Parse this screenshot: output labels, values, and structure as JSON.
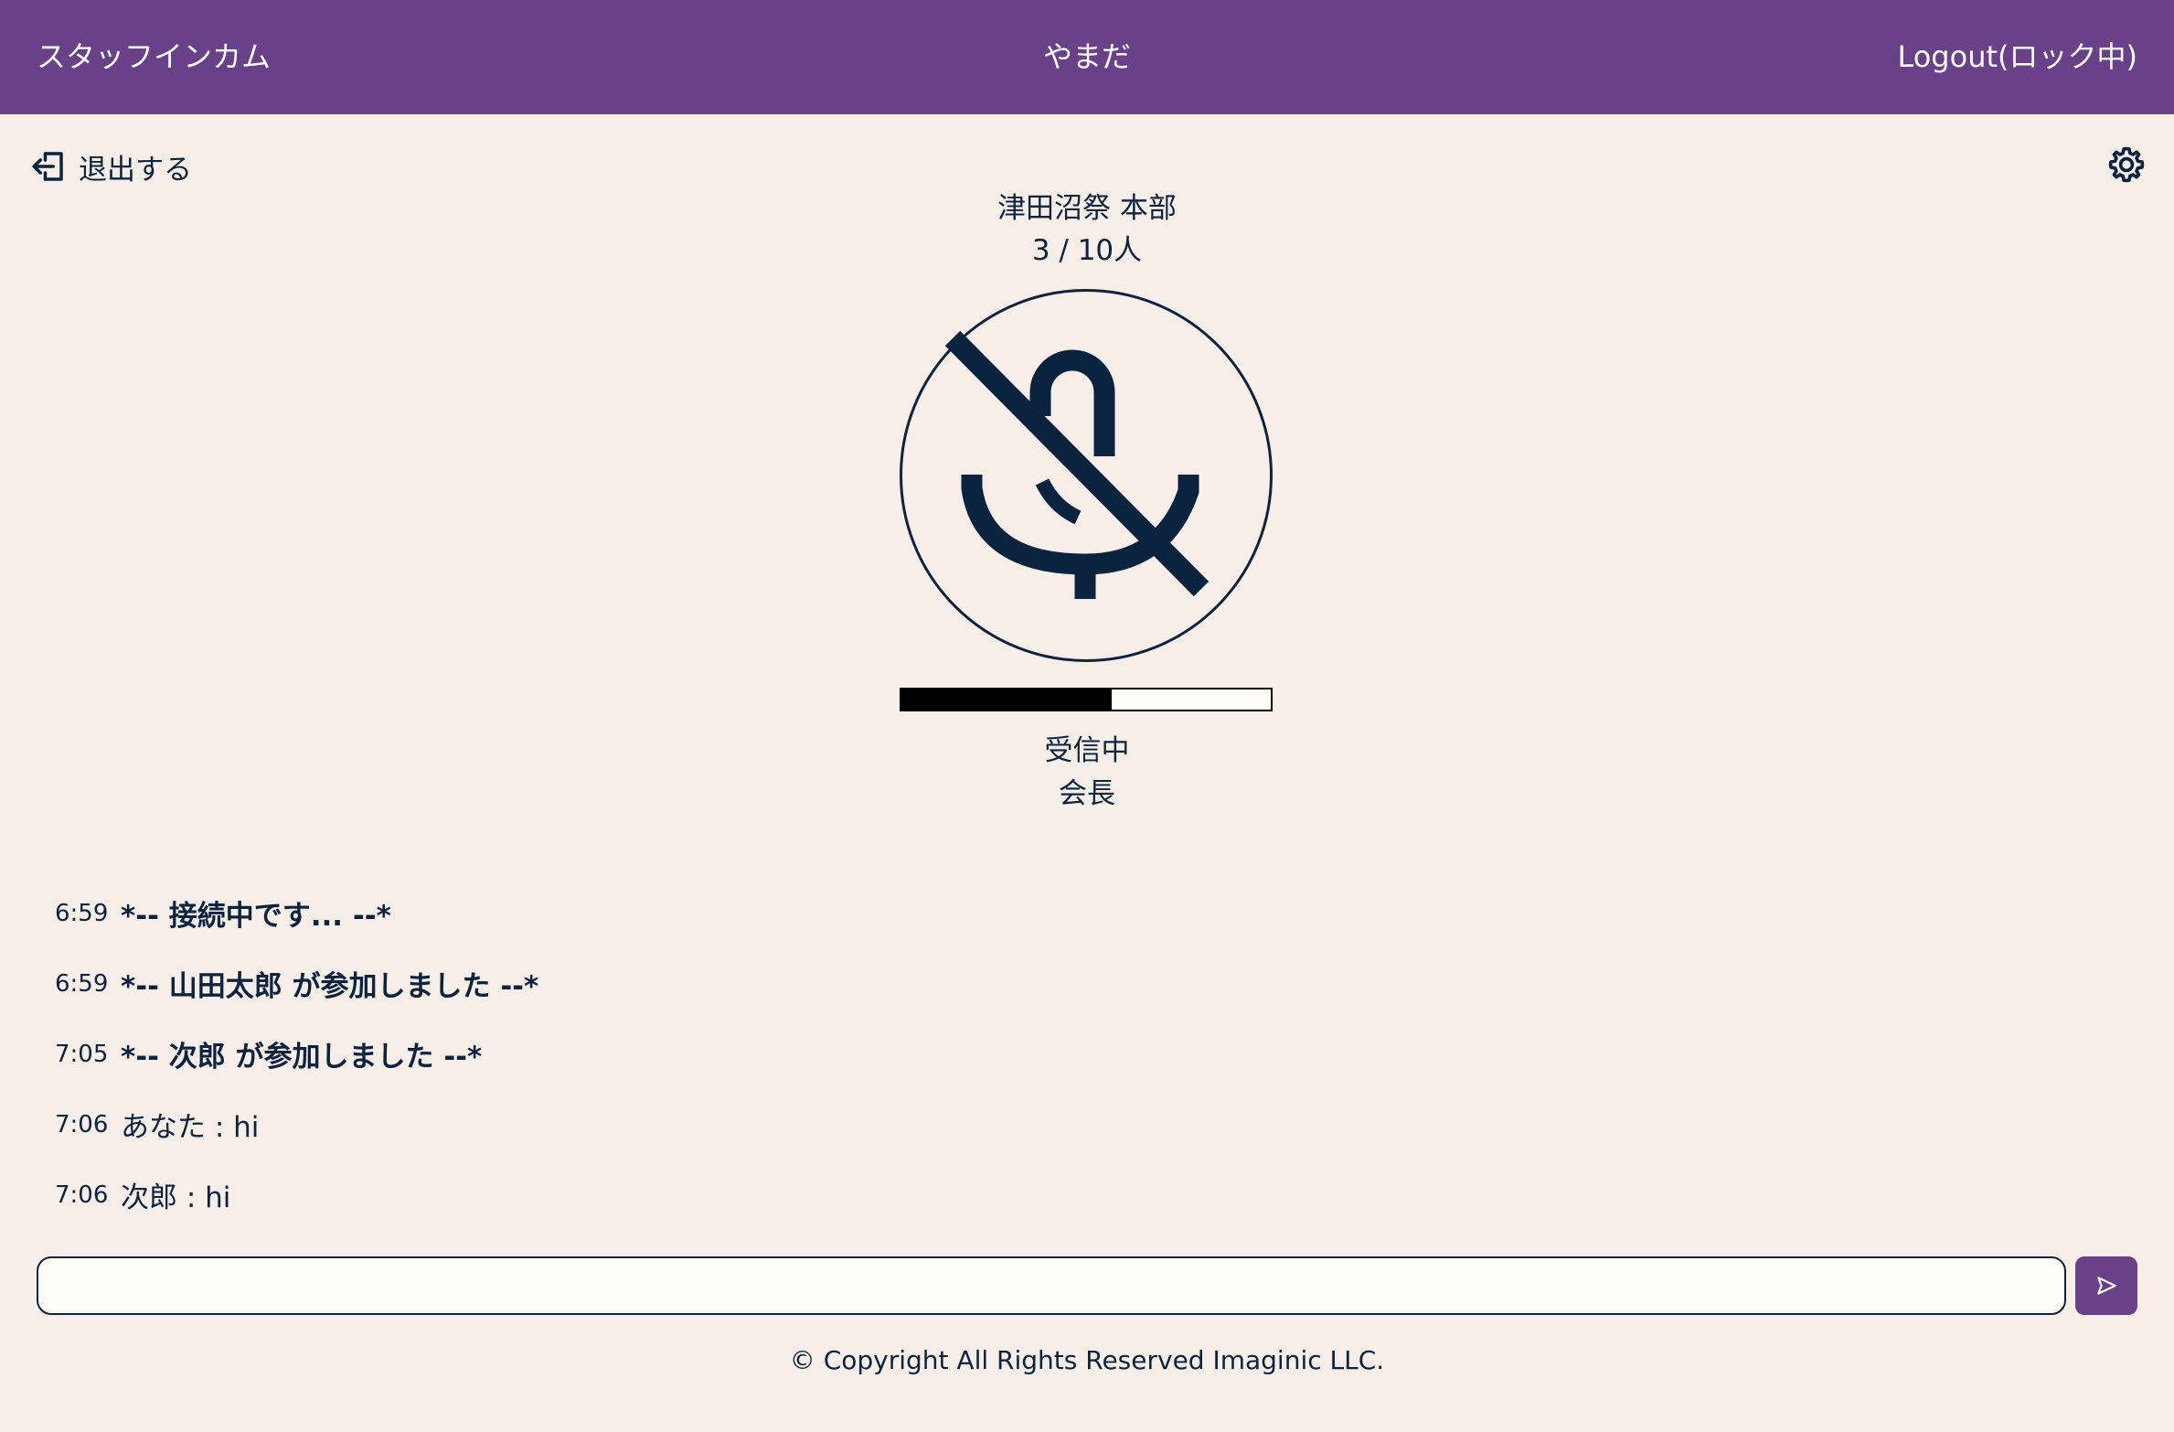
{
  "header": {
    "app_title": "スタッフインカム",
    "user_name": "やまだ",
    "logout_label": "Logout(ロック中)"
  },
  "toolbar": {
    "exit_label": "退出する",
    "exit_icon": "exit-icon",
    "settings_icon": "gear-icon"
  },
  "room": {
    "name": "津田沼祭 本部",
    "count": "3 / 10人"
  },
  "mic": {
    "icon": "mic-off-icon",
    "muted": true
  },
  "audio_level": {
    "value": 0.57
  },
  "status": {
    "state": "受信中",
    "speaker": "会長"
  },
  "messages": [
    {
      "time": "6:59",
      "text": "*-- 接続中です... --*",
      "system": true
    },
    {
      "time": "6:59",
      "text": "*-- 山田太郎 が参加しました --*",
      "system": true
    },
    {
      "time": "7:05",
      "text": "*-- 次郎 が参加しました --*",
      "system": true
    },
    {
      "time": "7:06",
      "text": "あなた :  hi",
      "system": false
    },
    {
      "time": "7:06",
      "text": "次郎 :  hi",
      "system": false
    }
  ],
  "chat_input": {
    "value": "",
    "placeholder": ""
  },
  "send_button": {
    "icon": "send-icon"
  },
  "footer": {
    "copyright": "© Copyright All Rights Reserved Imaginic LLC."
  },
  "colors": {
    "header_bg": "#684189",
    "page_bg": "#f7efe7",
    "text": "#0c2340"
  }
}
